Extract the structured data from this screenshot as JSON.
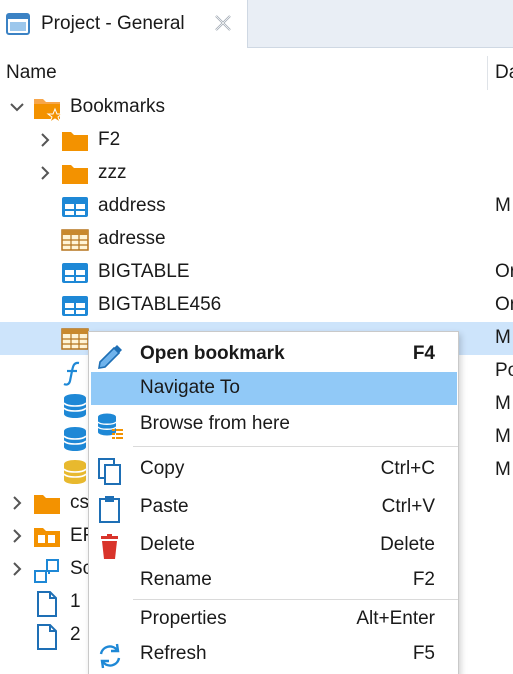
{
  "tab": {
    "title": "Project - General",
    "icon": "window-icon",
    "close_icon": "close-icon"
  },
  "columns": {
    "name": "Name",
    "description": "Da"
  },
  "tree": {
    "rows": [
      {
        "label": "Bookmarks",
        "desc": "",
        "icon": "bookmark-folder-icon",
        "expanded": true
      },
      {
        "label": "F2",
        "desc": "",
        "icon": "folder-icon"
      },
      {
        "label": "zzz",
        "desc": "",
        "icon": "folder-icon"
      },
      {
        "label": "address",
        "desc": "M",
        "icon": "table-icon"
      },
      {
        "label": "adresse",
        "desc": "",
        "icon": "grid-table-icon"
      },
      {
        "label": "BIGTABLE",
        "desc": "Or",
        "icon": "table-icon"
      },
      {
        "label": "BIGTABLE456",
        "desc": "Or",
        "icon": "table-icon"
      },
      {
        "label": "",
        "desc": "M",
        "icon": "grid-table-icon",
        "selected": true
      },
      {
        "label": "",
        "desc": "Po",
        "icon": "function-icon"
      },
      {
        "label": "",
        "desc": "M",
        "icon": "database-icon"
      },
      {
        "label": "",
        "desc": "M",
        "icon": "database-icon"
      },
      {
        "label": "",
        "desc": "M",
        "icon": "database-yellow-icon"
      },
      {
        "label": "cs",
        "desc": "",
        "icon": "folder-icon"
      },
      {
        "label": "EF",
        "desc": "",
        "icon": "er-diagram-folder-icon"
      },
      {
        "label": "Sc",
        "desc": "",
        "icon": "scripts-icon"
      },
      {
        "label": "1",
        "desc": "",
        "icon": "file-icon"
      },
      {
        "label": "2",
        "desc": "",
        "icon": "file-icon"
      }
    ]
  },
  "menu": {
    "items": [
      {
        "label": "Open bookmark",
        "shortcut": "F4",
        "icon": "pencil-icon"
      },
      {
        "label": "Navigate To",
        "shortcut": "",
        "icon": ""
      },
      {
        "label": "Browse from here",
        "shortcut": "",
        "icon": "browse-database-icon"
      },
      {
        "label": "Copy",
        "shortcut": "Ctrl+C",
        "icon": "copy-icon"
      },
      {
        "label": "Paste",
        "shortcut": "Ctrl+V",
        "icon": "paste-icon"
      },
      {
        "label": "Delete",
        "shortcut": "Delete",
        "icon": "trash-icon"
      },
      {
        "label": "Rename",
        "shortcut": "F2",
        "icon": ""
      },
      {
        "label": "Properties",
        "shortcut": "Alt+Enter",
        "icon": ""
      },
      {
        "label": "Refresh",
        "shortcut": "F5",
        "icon": "refresh-icon"
      }
    ]
  },
  "colors": {
    "selection": "#cde4fb",
    "menu_highlight": "#91c9f7",
    "folder": "#f39200",
    "table_blue": "#1e88d6"
  }
}
